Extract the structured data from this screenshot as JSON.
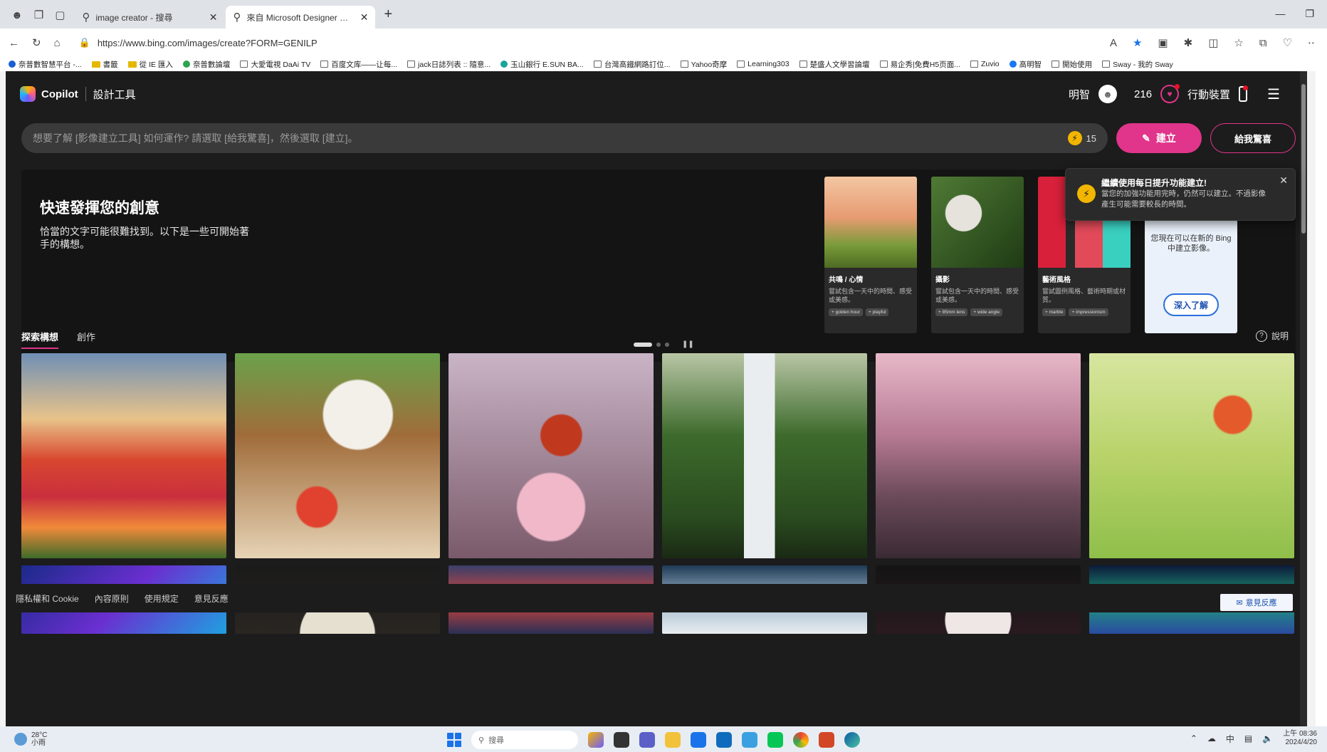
{
  "browser": {
    "tabs": [
      {
        "title": "image creator - 搜尋",
        "active": false
      },
      {
        "title": "來自 Microsoft Designer 的影像建立工具",
        "active": true
      }
    ],
    "url": "https://www.bing.com/images/create?FORM=GENILP",
    "bookmarks": [
      "奈普數智慧平台 -...",
      "書籤",
      "從 IE 匯入",
      "奈普數論壇",
      "大愛電視 DaAi TV",
      "百度文库——让每...",
      "jack日誌列表 :: 隨意...",
      "玉山銀行 E.SUN BA...",
      "台灣高鐵網路訂位...",
      "Yahoo奇摩",
      "Learning303",
      "楚盛人文學習論壇",
      "易企秀|免費H5页面...",
      "Zuvio",
      "高明智",
      "開始使用",
      "Sway - 我的 Sway"
    ]
  },
  "header": {
    "brand": "Copilot",
    "tool": "設計工具",
    "user": "明智",
    "points": "216",
    "mobile": "行動裝置"
  },
  "search": {
    "placeholder": "想要了解 [影像建立工具] 如何運作? 請選取 [給我驚喜]，然後選取 [建立]。",
    "boosts": "15",
    "create_label": "建立",
    "surprise_label": "給我驚喜"
  },
  "hero": {
    "title": "快速發揮您的創意",
    "subtitle": "恰當的文字可能很難找到。以下是一些可開始著手的構想。",
    "cards": [
      {
        "title": "共鳴 / 心情",
        "desc": "嘗試包含一天中的時間、感受或美感。",
        "chips": [
          "+ golden hour",
          "+ playful"
        ]
      },
      {
        "title": "攝影",
        "desc": "嘗試包含一天中的時間、感受或美感。",
        "chips": [
          "+ 85mm lens",
          "+ wide angle"
        ]
      },
      {
        "title": "藝術風格",
        "desc": "嘗試圖例風格、藝術時期或材質。",
        "chips": [
          "+ marble",
          "+ impressionism"
        ]
      }
    ],
    "promo": {
      "text": "您現在可以在新的 Bing 中建立影像。",
      "button": "深入了解"
    }
  },
  "toast": {
    "title": "繼續使用每日提升功能建立!",
    "body": "當您的加強功能用完時，仍然可以建立。不過影像產生可能需要較長的時間。"
  },
  "tabs": {
    "explore": "探索構想",
    "create": "創作",
    "help": "說明"
  },
  "footer": {
    "links": [
      "隱私權和 Cookie",
      "內容原則",
      "使用規定",
      "意見反應"
    ],
    "feedback": "意見反應"
  },
  "taskbar": {
    "temp": "28°C",
    "weather": "小雨",
    "search": "搜尋",
    "time": "上午 08:36",
    "date": "2024/4/20",
    "ime": "中"
  }
}
